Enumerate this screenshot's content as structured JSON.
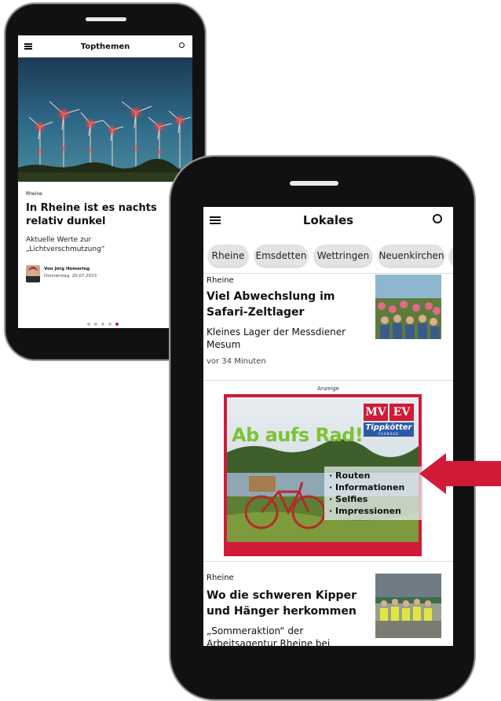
{
  "phone1": {
    "header_title": "Topthemen",
    "category": "Rheine",
    "headline": "In Rheine ist es nachts relativ dunkel",
    "teaser": "Aktuelle Werte zur „Lichtverschmutzung“",
    "author": "Von Jörg Homering",
    "date": "Donnerstag, 20.07.2023",
    "pager": {
      "count": 5,
      "active_index": 4
    }
  },
  "phone2": {
    "header_title": "Lokales",
    "chips": [
      "Rheine",
      "Emsdetten",
      "Wettringen",
      "Neuenkirchen"
    ],
    "articles": [
      {
        "category": "Rheine",
        "headline": "Viel Abwechslung im Safari-Zeltlager",
        "teaser": "Kleines Lager der Messdiener Mesum",
        "time": "vor 34 Minuten"
      },
      {
        "category": "Rheine",
        "headline": "Wo die schweren Kipper und Hänger herkommen",
        "teaser": "„Sommeraktion“ der Arbeitsagentur Rheine bei"
      }
    ],
    "ad": {
      "label": "Anzeige",
      "headline": "Ab aufs Rad!",
      "logo_mv": "MV",
      "logo_ev": "EV",
      "brand": "Tippkötter",
      "brand_sub": "FAHRRAD",
      "bullets": [
        "Routen",
        "Informationen",
        "Selfies",
        "Impressionen"
      ]
    }
  },
  "colors": {
    "accent": "#d11a37",
    "ad_title": "#7ec234",
    "chip_bg": "#e3e3e3"
  }
}
